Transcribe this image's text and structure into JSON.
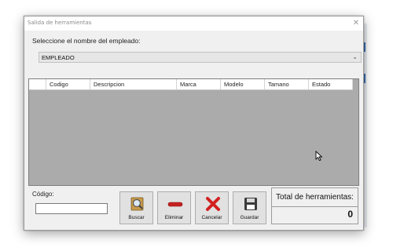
{
  "window": {
    "title": "Salida de herramientas"
  },
  "employee_prompt": "Seleccione el nombre del empleado:",
  "employee_combo": {
    "selected": "EMPLEADO"
  },
  "grid": {
    "columns": [
      "Codigo",
      "Descripcion",
      "Marca",
      "Modelo",
      "Tamano",
      "Estado"
    ]
  },
  "codigo": {
    "label": "Código:",
    "value": ""
  },
  "buttons": {
    "buscar": "Buscar",
    "eliminar": "Eliminar",
    "cancelar": "Cancelar",
    "guardar": "Guardar"
  },
  "total": {
    "label": "Total de herramientas:",
    "value": "0"
  },
  "icons": {
    "buscar": "search-icon",
    "eliminar": "minus-icon",
    "cancelar": "close-x-icon",
    "guardar": "floppy-disk-icon"
  },
  "colors": {
    "grid_background": "#ababab",
    "window_background": "#f0f0f0",
    "cancel_red": "#d32020",
    "minus_red": "#c62020"
  }
}
